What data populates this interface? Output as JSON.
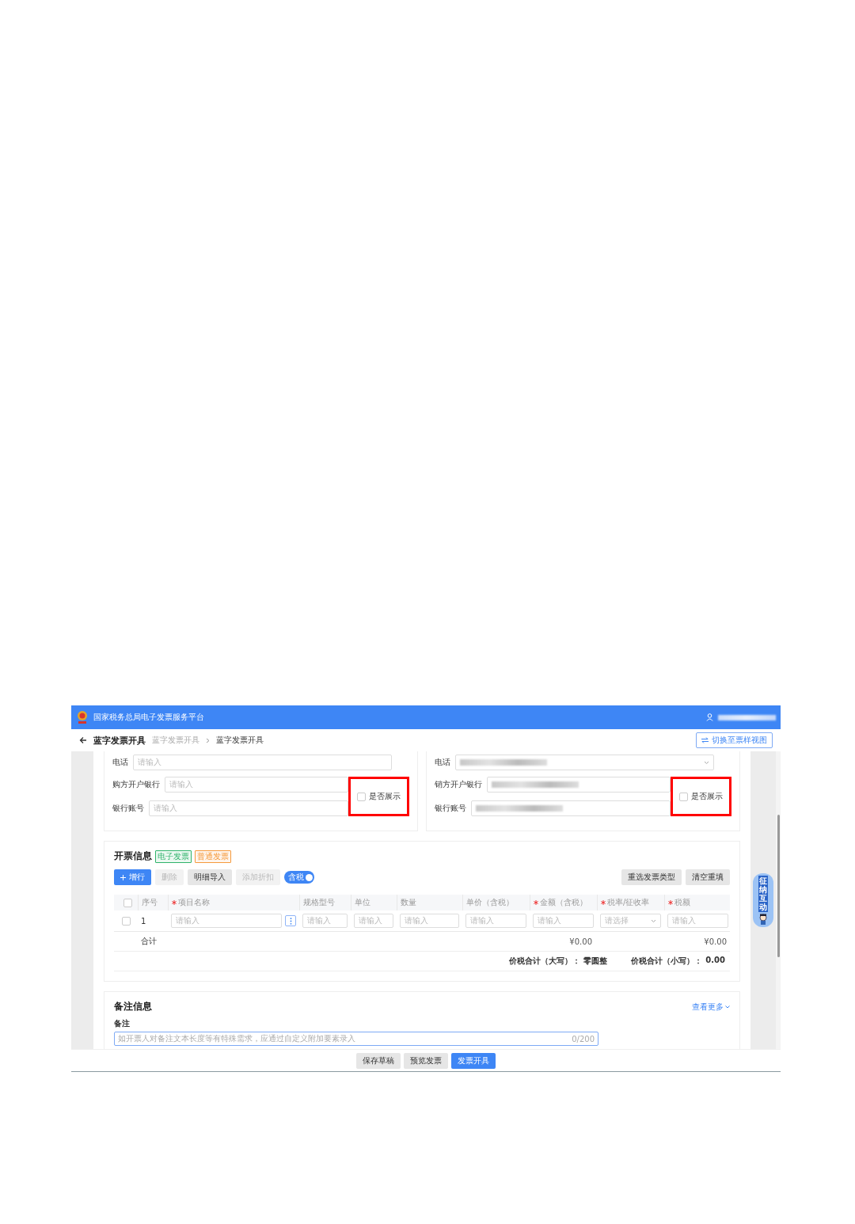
{
  "header": {
    "title": "国家税务总局电子发票服务平台",
    "user_hidden": true
  },
  "page": {
    "title": "蓝字发票开具",
    "breadcrumb": [
      {
        "label": "蓝字发票开具",
        "selected": false
      },
      {
        "label": "蓝字发票开具",
        "selected": true
      }
    ],
    "switch_button": "切换至票样视图"
  },
  "parties": [
    {
      "phone": {
        "label": "电话",
        "kind": "input",
        "placeholder": "请输入"
      },
      "bank": {
        "label": "购方开户银行",
        "placeholder": "请输入"
      },
      "account": {
        "label": "银行账号",
        "placeholder": "请输入"
      },
      "display_option": {
        "label": "是否展示",
        "checked": false,
        "highlighted": true
      }
    },
    {
      "phone": {
        "label": "电话",
        "kind": "select",
        "value_hidden": true
      },
      "bank": {
        "label": "销方开户银行",
        "value_hidden": true
      },
      "account": {
        "label": "银行账号",
        "value_hidden": true
      },
      "display_option": {
        "label": "是否展示",
        "checked": false,
        "highlighted": true
      }
    }
  ],
  "invoice": {
    "title": "开票信息",
    "tags": [
      {
        "label": "电子发票",
        "color": "#2fb36b"
      },
      {
        "label": "普通发票",
        "color": "#f59a3c"
      }
    ],
    "toolbar": [
      {
        "label": "增行",
        "kind": "primary"
      },
      {
        "label": "删除",
        "kind": "disabled"
      },
      {
        "label": "明细导入",
        "kind": "default"
      },
      {
        "label": "添加折扣",
        "kind": "disabled"
      }
    ],
    "tax_toggle": {
      "label": "含税",
      "on": true
    },
    "right_buttons": [
      "重选发票类型",
      "清空重填"
    ],
    "columns": [
      {
        "kind": "checkbox",
        "checked": false
      },
      {
        "kind": "text",
        "label": "序号",
        "required": false
      },
      {
        "label": "项目名称",
        "required": true
      },
      {
        "label": "规格型号",
        "required": false
      },
      {
        "label": "单位",
        "required": false
      },
      {
        "label": "数量",
        "required": false
      },
      {
        "label": "单价（含税）",
        "required": false
      },
      {
        "label": "金额（含税）",
        "required": true
      },
      {
        "label": "税率/征收率",
        "required": true
      },
      {
        "label": "税额",
        "required": true
      }
    ],
    "rows": [
      {
        "cells": [
          {
            "kind": "checkbox",
            "checked": false
          },
          {
            "kind": "text",
            "text": "1"
          },
          {
            "kind": "input",
            "placeholder": "请输入",
            "more": true
          },
          {
            "kind": "input",
            "placeholder": "请输入"
          },
          {
            "kind": "input",
            "placeholder": "请输入"
          },
          {
            "kind": "input",
            "placeholder": "请输入"
          },
          {
            "kind": "input",
            "placeholder": "请输入"
          },
          {
            "kind": "input",
            "placeholder": "请输入"
          },
          {
            "kind": "select",
            "placeholder": "请选择"
          },
          {
            "kind": "input",
            "placeholder": "请输入"
          }
        ]
      }
    ],
    "total_label": "合计",
    "total_amount": "¥0.00",
    "total_tax": "¥0.00",
    "sum_words_label": "价税合计（大写）：",
    "sum_words": "零圆整",
    "sum_label": "价税合计（小写）：",
    "sum": "0.00"
  },
  "remarks": {
    "title": "备注信息",
    "more_link": "查看更多",
    "label": "备注",
    "placeholder": "如开票人对备注文本长度等有特殊需求，应通过自定义附加要素录入",
    "counter": "0/200"
  },
  "assistant": {
    "label": "征纳互动"
  },
  "footer": {
    "buttons": [
      {
        "label": "保存草稿",
        "kind": "default"
      },
      {
        "label": "预览发票",
        "kind": "default"
      },
      {
        "label": "发票开具",
        "kind": "primary"
      }
    ]
  }
}
